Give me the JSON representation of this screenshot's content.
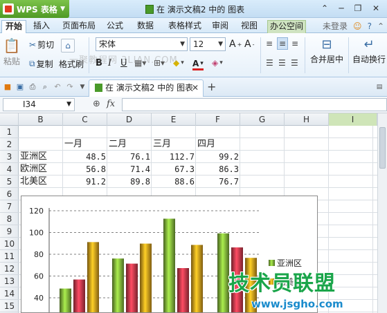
{
  "titlebar": {
    "app_name": "WPS 表格",
    "doc_title": "在 演示文稿2 中的 图表",
    "colors": {
      "app_green": "#5aa82e",
      "bar": "#c3ddf3"
    }
  },
  "menu": {
    "tabs": [
      "开始",
      "插入",
      "页面布局",
      "公式",
      "数据",
      "表格样式",
      "审阅",
      "视图",
      "办公空间"
    ],
    "active": "开始",
    "login": "未登录"
  },
  "ribbon": {
    "paste": "粘贴",
    "cut": "剪切",
    "copy": "复制",
    "format_painter": "格式刷",
    "font_name": "宋体",
    "font_size": "12",
    "bold": "B",
    "italic": "I",
    "underline": "U",
    "merge_center": "合并居中",
    "auto_wrap": "自动换行",
    "watermark": "一聚教程网 3LIAN.COM"
  },
  "quickbar": {
    "doc_tab": "在 演示文稿2 中的 图表"
  },
  "formula_bar": {
    "cell_ref": "I34",
    "fx": "fx",
    "value": ""
  },
  "grid": {
    "columns": [
      "B",
      "C",
      "D",
      "E",
      "F",
      "G",
      "H",
      "I"
    ],
    "selected_column": "I",
    "rows": [
      "1",
      "2",
      "3",
      "4",
      "5",
      "6",
      "7",
      "8",
      "9",
      "10",
      "11",
      "12",
      "13",
      "14",
      "15"
    ],
    "headers": [
      "一月",
      "二月",
      "三月",
      "四月"
    ],
    "data": [
      {
        "region": "亚洲区",
        "values": [
          "48.5",
          "76.1",
          "112.7",
          "99.2"
        ]
      },
      {
        "region": "欧洲区",
        "values": [
          "56.8",
          "71.4",
          "67.3",
          "86.3"
        ]
      },
      {
        "region": "北美区",
        "values": [
          "91.2",
          "89.8",
          "88.6",
          "76.7"
        ]
      }
    ]
  },
  "chart_data": {
    "type": "bar",
    "categories": [
      "一月",
      "二月",
      "三月",
      "四月"
    ],
    "series": [
      {
        "name": "亚洲区",
        "values": [
          48.5,
          76.1,
          112.7,
          99.2
        ],
        "color": "#7fb03a"
      },
      {
        "name": "欧洲区",
        "values": [
          56.8,
          71.4,
          67.3,
          86.3
        ],
        "color": "#c8384a"
      },
      {
        "name": "北美区",
        "values": [
          91.2,
          89.8,
          88.6,
          76.7
        ],
        "color": "#d49a1c"
      }
    ],
    "y_ticks": [
      "120",
      "100",
      "80",
      "60",
      "40"
    ],
    "ylim": [
      0,
      120
    ],
    "grid": "dashed horizontal",
    "legend": "right",
    "legend_visible": [
      "亚洲区",
      "北美区"
    ]
  },
  "site_watermark": {
    "name": "技术员联盟",
    "url": "www.jsgho.com"
  }
}
